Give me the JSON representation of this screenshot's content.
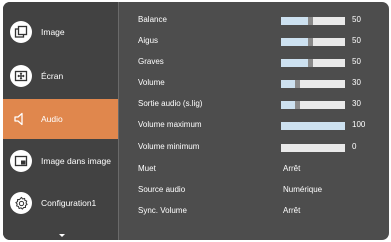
{
  "sidebar": {
    "items": [
      {
        "label": "Image",
        "icon": "picture-frame-icon",
        "active": false
      },
      {
        "label": "Écran",
        "icon": "screen-icon",
        "active": false
      },
      {
        "label": "Audio",
        "icon": "speaker-icon",
        "active": true
      },
      {
        "label": "Image dans image",
        "icon": "picture-in-picture-icon",
        "active": false
      },
      {
        "label": "Configuration1",
        "icon": "gear-icon",
        "active": false
      }
    ]
  },
  "settings": [
    {
      "label": "Balance",
      "value": "50",
      "level": 0.5
    },
    {
      "label": "Aigus",
      "value": "50",
      "level": 0.5
    },
    {
      "label": "Graves",
      "value": "50",
      "level": 0.5
    },
    {
      "label": "Volume",
      "value": "30",
      "level": 0.3
    },
    {
      "label": "Sortie audio (s.lig)",
      "value": "30",
      "level": 0.3
    },
    {
      "label": "Volume maximum",
      "value": "100",
      "level": 1.0
    },
    {
      "label": "Volume minimum",
      "value": "0",
      "level": 0.0
    },
    {
      "label": "Muet",
      "text": "Arrêt"
    },
    {
      "label": "Source audio",
      "text": "Numérique"
    },
    {
      "label": "Sync. Volume",
      "text": "Arrêt"
    }
  ],
  "colors": {
    "panel": "#4d4d4d",
    "sidebar": "#424242",
    "active": "#e0874d",
    "bar_track": "#e9e9e9",
    "bar_fill": "#cde1f0"
  }
}
